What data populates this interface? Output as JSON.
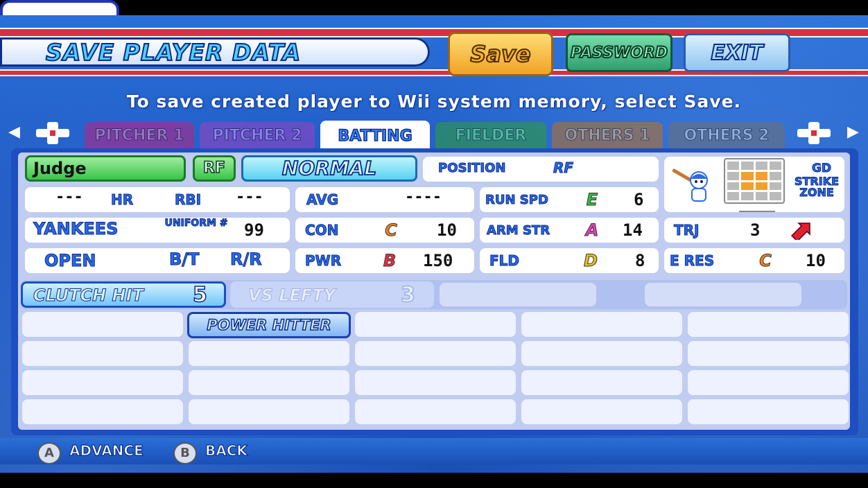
{
  "header": {
    "title": "Save Player Data",
    "buttons": {
      "save": "Save",
      "password": "Password",
      "exit": "Exit"
    }
  },
  "instruction": "To save created player to Wii system memory, select Save.",
  "tabs": [
    "Pitcher 1",
    "Pitcher 2",
    "Batting",
    "Fielder",
    "Others 1",
    "Others 2"
  ],
  "active_tab": "Batting",
  "player": {
    "name": "Judge",
    "position_badge": "RF",
    "type": "Normal",
    "position_label": "Position",
    "position_value": "RF",
    "hr_value": "---",
    "hr_label": "HR",
    "rbi_label": "RBI",
    "rbi_value": "---",
    "avg_label": "AVG",
    "avg_value": "----",
    "team": "Yankees",
    "uniform_label": "Uniform #",
    "uniform_value": "99",
    "status": "Open",
    "bt_label": "B/T",
    "bt_value": "R/R"
  },
  "stats": {
    "run_spd": {
      "label": "Run Spd",
      "grade": "E",
      "value": "6",
      "grade_color": "#30c040"
    },
    "con": {
      "label": "Con",
      "grade": "C",
      "value": "10",
      "grade_color": "#f08020"
    },
    "arm_str": {
      "label": "Arm Str",
      "grade": "A",
      "value": "14",
      "grade_color": "#e040c0"
    },
    "trj": {
      "label": "TRJ",
      "value": "3"
    },
    "pwr": {
      "label": "Pwr",
      "grade": "B",
      "value": "150",
      "grade_color": "#e83040"
    },
    "fld": {
      "label": "Fld",
      "grade": "D",
      "value": "8",
      "grade_color": "#e8c020"
    },
    "e_res": {
      "label": "E Res",
      "grade": "C",
      "value": "10",
      "grade_color": "#f08020"
    }
  },
  "strike_zone": {
    "label_1": "Gd",
    "label_2": "Strike",
    "label_3": "Zone"
  },
  "abilities": [
    {
      "name": "Clutch Hit",
      "value": "5"
    },
    {
      "name": "VS Lefty",
      "value": "3"
    }
  ],
  "special_abilities": [
    "Power Hitter"
  ],
  "footer": {
    "a_label": "Advance",
    "b_label": "Back",
    "a_key": "A",
    "b_key": "B"
  }
}
